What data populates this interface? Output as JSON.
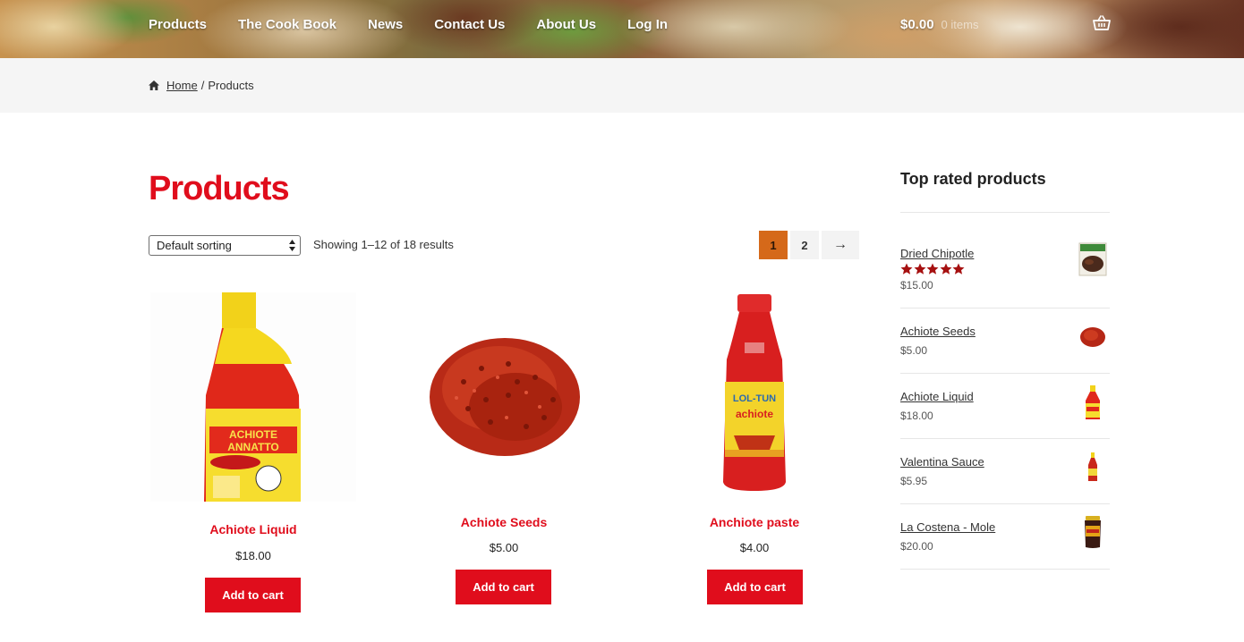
{
  "header": {
    "nav": [
      "Products",
      "The Cook Book",
      "News",
      "Contact Us",
      "About Us",
      "Log In"
    ],
    "cart_amount": "$0.00",
    "cart_count": "0 items"
  },
  "breadcrumb": {
    "home": "Home",
    "separator": "/",
    "current": "Products"
  },
  "main": {
    "title": "Products",
    "sort_value": "Default sorting",
    "result_count": "Showing 1–12 of 18 results",
    "pagination": {
      "pages": [
        "1",
        "2"
      ],
      "current": "1",
      "next": "→"
    },
    "products": [
      {
        "name": "Achiote Liquid",
        "price": "$18.00",
        "button": "Add to cart"
      },
      {
        "name": "Achiote Seeds",
        "price": "$5.00",
        "button": "Add to cart"
      },
      {
        "name": "Anchiote paste",
        "price": "$4.00",
        "button": "Add to cart"
      }
    ]
  },
  "sidebar": {
    "title": "Top rated products",
    "items": [
      {
        "name": "Dried Chipotle",
        "price": "$15.00",
        "rating": 5
      },
      {
        "name": "Achiote Seeds",
        "price": "$5.00"
      },
      {
        "name": "Achiote Liquid",
        "price": "$18.00"
      },
      {
        "name": "Valentina Sauce",
        "price": "$5.95"
      },
      {
        "name": "La Costena - Mole",
        "price": "$20.00"
      }
    ]
  },
  "colors": {
    "accent_red": "#e00d1c",
    "pagination_current": "#d5691a",
    "star": "#a61010"
  },
  "icons": [
    "home-icon",
    "basket-icon",
    "star-icon",
    "select-arrows-icon"
  ]
}
